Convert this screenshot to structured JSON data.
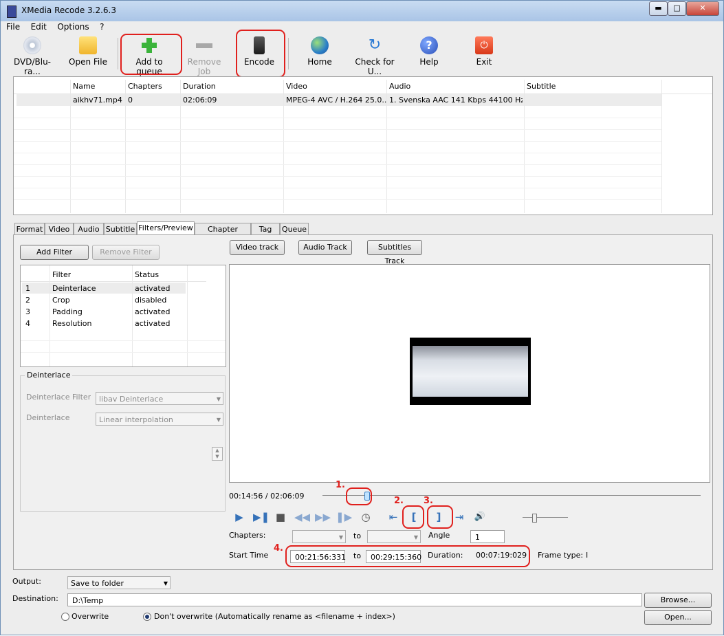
{
  "window": {
    "title": "XMedia Recode 3.2.6.3"
  },
  "menu": [
    "File",
    "Edit",
    "Options",
    "?"
  ],
  "toolbar": {
    "dvd": "DVD/Blu-ra...",
    "open_file": "Open File",
    "add_to_queue": "Add to queue",
    "remove_job": "Remove Job",
    "encode": "Encode",
    "home": "Home",
    "check_updates": "Check for U...",
    "help": "Help",
    "exit": "Exit"
  },
  "joblist": {
    "headers": [
      "Name",
      "Chapters",
      "Duration",
      "Video",
      "Audio",
      "Subtitle"
    ],
    "rows": [
      [
        "aikhv71.mp4",
        "0",
        "02:06:09",
        "MPEG-4 AVC / H.264 25.0...",
        "1. Svenska AAC  141 Kbps 44100 Hz...",
        ""
      ]
    ]
  },
  "tabs": [
    "Format",
    "Video",
    "Audio",
    "Subtitle",
    "Filters/Preview",
    "Chapter Editor",
    "Tag",
    "Queue"
  ],
  "active_tab": "Filters/Preview",
  "filters": {
    "add_label": "Add Filter",
    "remove_label": "Remove Filter",
    "headers": [
      "Filter",
      "Status"
    ],
    "rows": [
      [
        "1",
        "Deinterlace",
        "activated"
      ],
      [
        "2",
        "Crop",
        "disabled"
      ],
      [
        "3",
        "Padding",
        "activated"
      ],
      [
        "4",
        "Resolution",
        "activated"
      ]
    ]
  },
  "deinterlace": {
    "group_label": "Deinterlace",
    "filter_label": "Deinterlace Filter",
    "filter_value": "libav Deinterlace",
    "mode_label": "Deinterlace",
    "mode_value": "Linear interpolation"
  },
  "preview": {
    "video_track": "Video track",
    "audio_track": "Audio Track",
    "subtitles_track": "Subtitles Track",
    "time": "00:14:56 / 02:06:09",
    "position_fraction": 0.118,
    "chapters_label": "Chapters:",
    "to_label": "to",
    "angle_label": "Angle",
    "angle_value": "1",
    "start_time_label": "Start Time",
    "start_time": "00:21:56:331",
    "end_time": "00:29:15:360",
    "duration_label": "Duration:",
    "duration": "00:07:19:029",
    "frame_type_label": "Frame type:",
    "frame_type": "I"
  },
  "annotations": [
    "1.",
    "2.",
    "3.",
    "4."
  ],
  "bottom": {
    "output_label": "Output:",
    "output_value": "Save to folder",
    "destination_label": "Destination:",
    "destination_value": "D:\\Temp",
    "browse": "Browse...",
    "open": "Open...",
    "overwrite": "Overwrite",
    "dont_overwrite": "Don't overwrite (Automatically rename as <filename + index>)"
  },
  "colors": {
    "highlight": "#e0201d",
    "accent": "#3672b9"
  }
}
